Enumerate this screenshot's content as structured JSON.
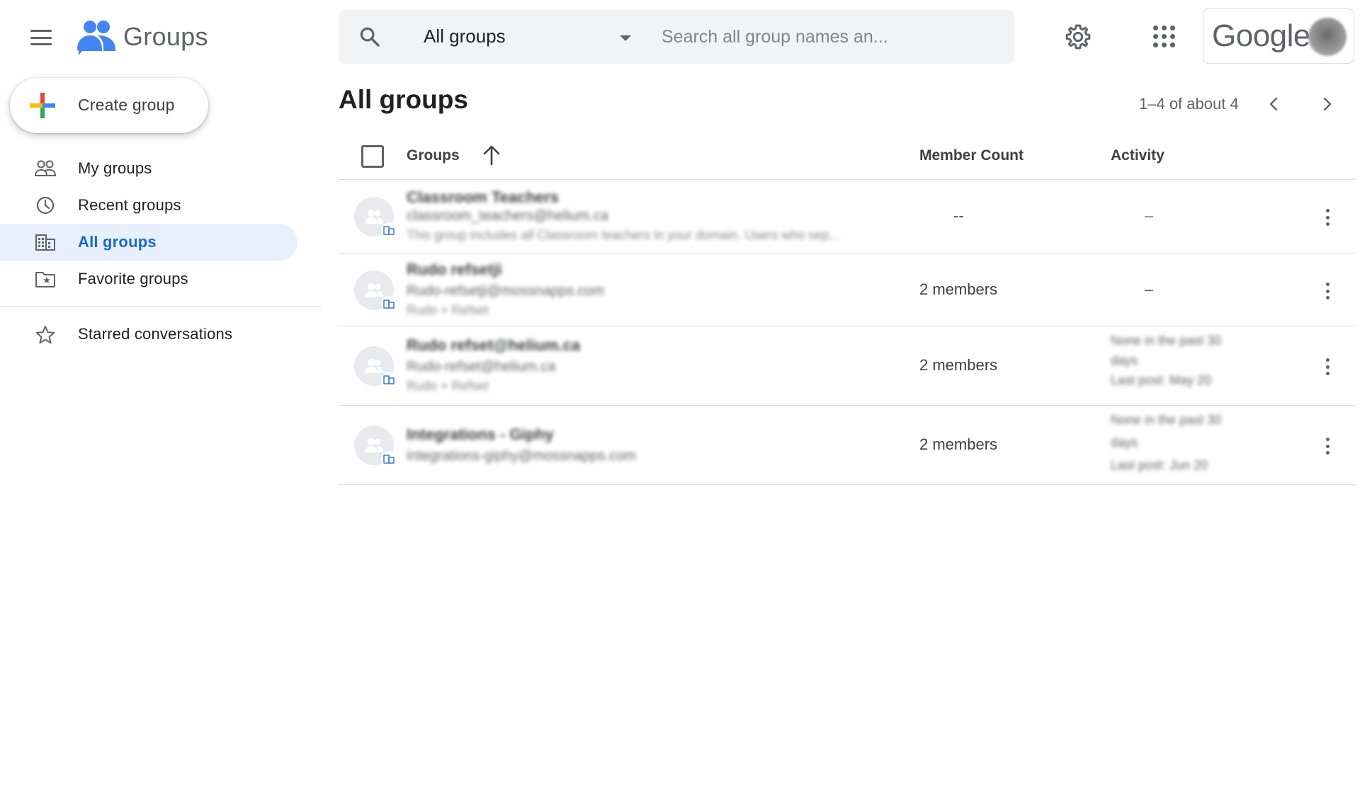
{
  "app": {
    "name": "Groups"
  },
  "header": {
    "search_scope": "All groups",
    "search_placeholder": "Search all group names an...",
    "account_label": "Google"
  },
  "sidebar": {
    "create_label": "Create group",
    "items": [
      {
        "label": "My groups",
        "icon": "people-icon",
        "active": false
      },
      {
        "label": "Recent groups",
        "icon": "clock-icon",
        "active": false
      },
      {
        "label": "All groups",
        "icon": "building-icon",
        "active": true
      },
      {
        "label": "Favorite groups",
        "icon": "star-folder-icon",
        "active": false
      }
    ],
    "starred_label": "Starred conversations"
  },
  "main": {
    "title": "All groups",
    "pager_text": "1–4 of about 4",
    "columns": {
      "groups": "Groups",
      "members": "Member Count",
      "activity": "Activity"
    },
    "rows": [
      {
        "name": "Classroom Teachers",
        "email": "classroom_teachers@helium.ca",
        "desc": "This group includes all Classroom teachers in your domain. Users who sep...",
        "members": "--",
        "activity_dash": "–",
        "activity_lines": []
      },
      {
        "name": "Rudo refsetji",
        "email": "Rudo-refsetji@mossnapps.com",
        "desc": "Rudo + Refset",
        "members": "2 members",
        "activity_dash": "–",
        "activity_lines": []
      },
      {
        "name": "Rudo refset@helium.ca",
        "email": "Rudo-refset@helium.ca",
        "desc": "Rudo + Refset",
        "members": "2 members",
        "activity_dash": "",
        "activity_lines": [
          "None in the past 30",
          "days",
          "Last post: May 20"
        ]
      },
      {
        "name": "Integrations - Giphy",
        "email": "integrations-giphy@mossnapps.com",
        "desc": "",
        "members": "2 members",
        "activity_dash": "",
        "activity_lines": [
          "None in the past 30",
          "days",
          "Last post: Jun 20"
        ]
      }
    ]
  },
  "colors": {
    "accent": "#1967d2",
    "active_bg": "#e8f0fe",
    "icon_gray": "#5f6368"
  }
}
